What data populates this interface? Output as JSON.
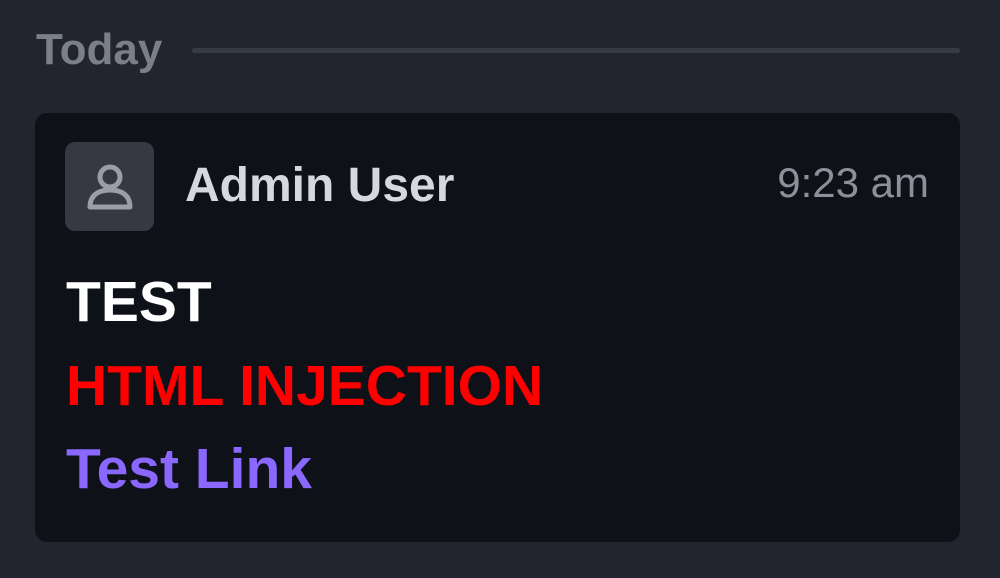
{
  "day_separator": {
    "label": "Today"
  },
  "message": {
    "author": "Admin User",
    "timestamp": "9:23 am",
    "avatar_icon": "user-icon",
    "lines": [
      {
        "text": "TEST",
        "color": "#ffffff"
      },
      {
        "text": "HTML INJECTION",
        "color": "#ff0000"
      },
      {
        "text": "Test Link",
        "color": "#8a67ff",
        "is_link": true
      }
    ]
  },
  "colors": {
    "background": "#22252e",
    "card": "#0f1118",
    "muted_text": "#7b7f89",
    "link": "#8a67ff",
    "injection": "#ff0000"
  }
}
